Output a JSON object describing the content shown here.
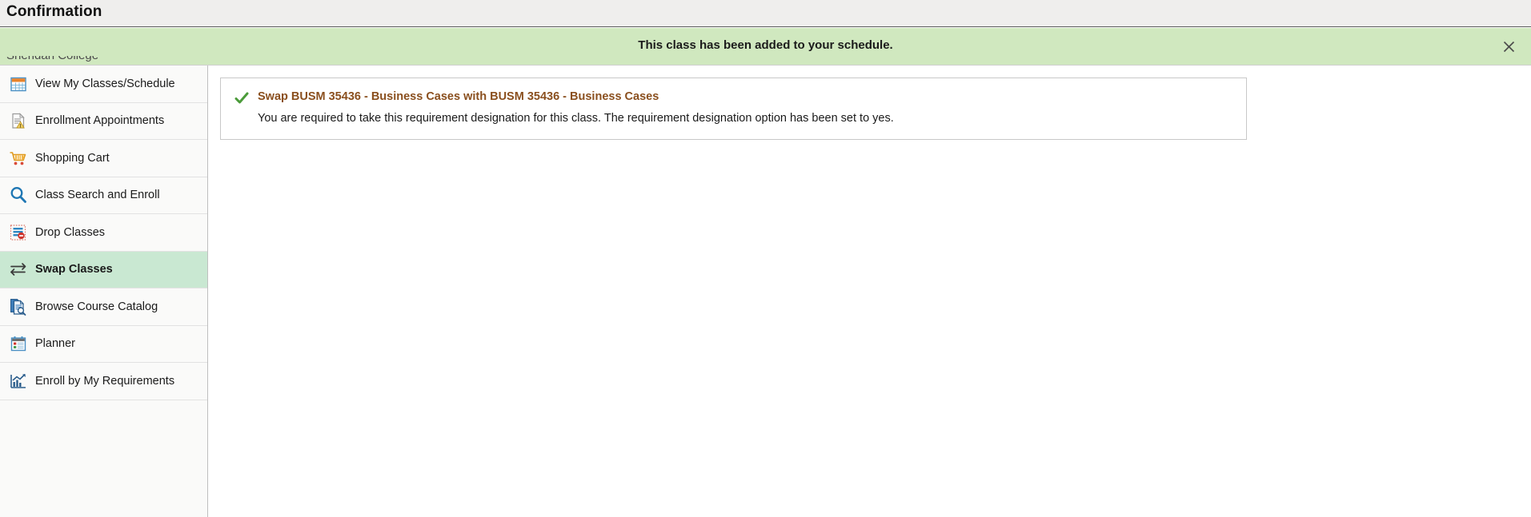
{
  "header": {
    "title": "Confirmation"
  },
  "banner": {
    "message": "This class has been added to your schedule.",
    "close_icon": "close-icon",
    "background_color": "#d0e8bf"
  },
  "brand": {
    "name": "Sheridan College"
  },
  "sidebar": {
    "items": [
      {
        "label": "View My Classes/Schedule",
        "icon": "calendar-icon",
        "selected": false
      },
      {
        "label": "Enrollment Appointments",
        "icon": "document-warning-icon",
        "selected": false
      },
      {
        "label": "Shopping Cart",
        "icon": "shopping-cart-icon",
        "selected": false
      },
      {
        "label": "Class Search and Enroll",
        "icon": "search-icon",
        "selected": false
      },
      {
        "label": "Drop Classes",
        "icon": "drop-classes-icon",
        "selected": false
      },
      {
        "label": "Swap Classes",
        "icon": "swap-arrows-icon",
        "selected": true
      },
      {
        "label": "Browse Course Catalog",
        "icon": "catalog-search-icon",
        "selected": false
      },
      {
        "label": "Planner",
        "icon": "planner-calendar-icon",
        "selected": false
      },
      {
        "label": "Enroll by My Requirements",
        "icon": "chart-requirements-icon",
        "selected": false
      }
    ]
  },
  "main": {
    "result": {
      "status_icon": "green-check-icon",
      "title": "Swap BUSM 35436 - Business Cases with BUSM 35436 - Business Cases",
      "body": "You are required to take this requirement designation for this class. The requirement designation option has been set to yes.",
      "title_color": "#8a4f1e"
    }
  }
}
